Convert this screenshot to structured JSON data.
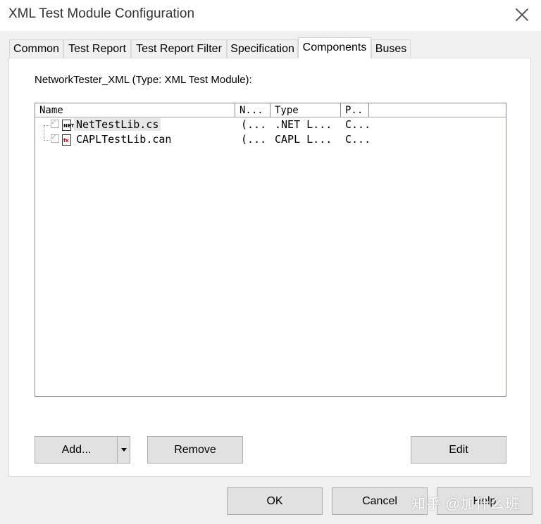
{
  "window": {
    "title": "XML Test Module Configuration"
  },
  "tabs": [
    "Common",
    "Test Report",
    "Test Report Filter",
    "Specification",
    "Components",
    "Buses"
  ],
  "active_tab": "Components",
  "panel": {
    "subtitle": "NetworkTester_XML (Type: XML Test Module):",
    "columns": [
      "Name",
      "N...",
      "Type",
      "P.."
    ],
    "rows": [
      {
        "name": "NetTestLib.cs",
        "n": "(...",
        "type": ".NET L...",
        "p": "C...",
        "icon_text": "NET",
        "checked": true
      },
      {
        "name": "CAPLTestLib.can",
        "n": "(...",
        "type": "CAPL L...",
        "p": "C...",
        "icon_text": "fx",
        "checked": true
      }
    ],
    "buttons": {
      "add": "Add...",
      "remove": "Remove",
      "edit": "Edit"
    }
  },
  "footer": {
    "ok": "OK",
    "cancel": "Cancel",
    "help": "Help"
  },
  "watermark": "知乎 @加什么班"
}
